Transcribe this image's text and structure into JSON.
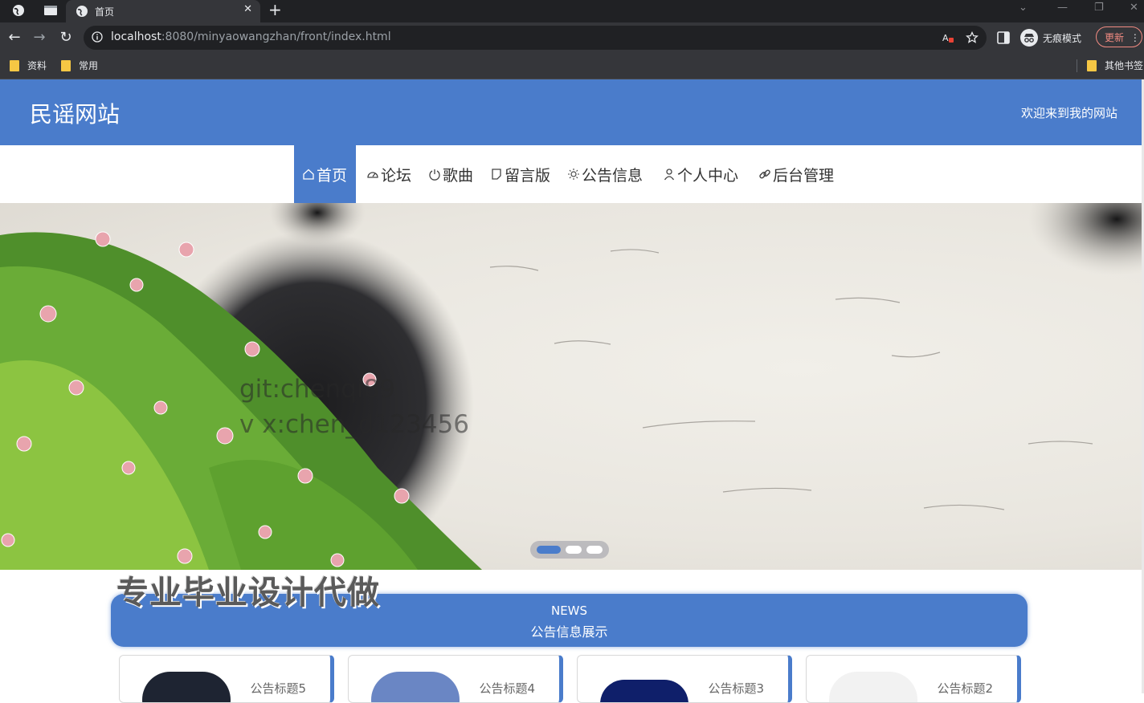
{
  "browser": {
    "tab_title": "首页",
    "url_host": "localhost",
    "url_rest": ":8080/minyaowangzhan/front/index.html",
    "profile_name": "无痕模式",
    "update_label": "更新",
    "bookmarks": [
      "资料",
      "常用"
    ],
    "other_bookmarks": "其他书签"
  },
  "site": {
    "title": "民谣网站",
    "welcome": "欢迎来到我的网站"
  },
  "nav": [
    {
      "label": "首页",
      "icon": "home-icon",
      "active": true
    },
    {
      "label": "论坛",
      "icon": "dashboard-icon",
      "active": false
    },
    {
      "label": "歌曲",
      "icon": "power-icon",
      "active": false
    },
    {
      "label": "留言版",
      "icon": "note-icon",
      "active": false
    },
    {
      "label": "公告信息",
      "icon": "sun-icon",
      "active": false
    },
    {
      "label": "个人中心",
      "icon": "user-icon",
      "active": false
    },
    {
      "label": "后台管理",
      "icon": "link-icon",
      "active": false
    }
  ],
  "banner": {
    "watermark_line1": "git:chenqi89",
    "watermark_line2": "v x:chen_d123456",
    "carousel_active_index": 0,
    "carousel_count": 3
  },
  "overlay_ad": "专业毕业设计代做",
  "news": {
    "heading_en": "NEWS",
    "heading_cn": "公告信息展示",
    "cards": [
      {
        "title": "公告标题5"
      },
      {
        "title": "公告标题4"
      },
      {
        "title": "公告标题3"
      },
      {
        "title": "公告标题2"
      }
    ]
  },
  "colors": {
    "brand": "#4a7ccb",
    "chrome_dark": "#202124",
    "chrome_mid": "#35363a"
  }
}
